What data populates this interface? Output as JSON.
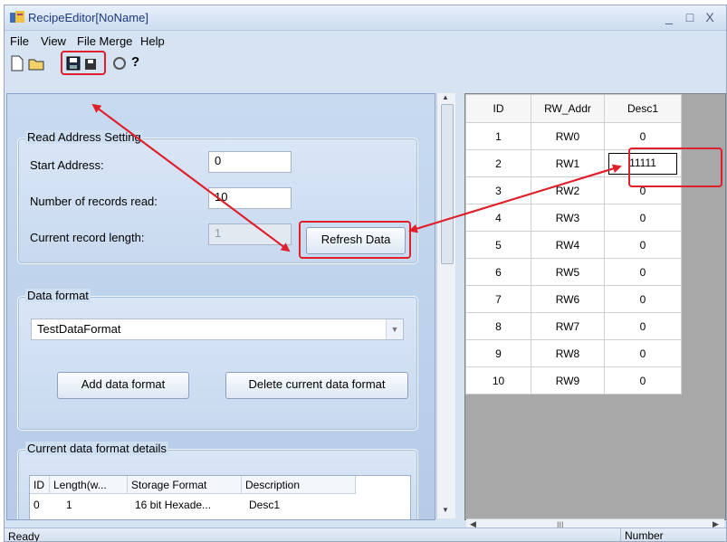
{
  "window": {
    "title": "RecipeEditor[NoName]",
    "minimize": "_",
    "maximize": "□",
    "close": "X"
  },
  "menu": {
    "file": "File",
    "view": "View",
    "file_merge": "File Merge",
    "help": "Help"
  },
  "toolbar": {
    "icons": [
      "new-icon",
      "open-icon",
      "save-icon",
      "save-as-icon",
      "refresh-icon",
      "help-icon"
    ],
    "help_glyph": "?"
  },
  "read_address": {
    "group_label": "Read Address Setting",
    "start_label": "Start Address:",
    "start_value": "0",
    "count_label": "Number of records read:",
    "count_value": "10",
    "length_label": "Current record length:",
    "length_value": "1",
    "refresh_button": "Refresh Data"
  },
  "data_format": {
    "group_label": "Data format",
    "selected": "TestDataFormat",
    "add_button": "Add data format",
    "delete_button": "Delete current data format"
  },
  "details": {
    "group_label": "Current data format details",
    "columns": [
      "ID",
      "Length(w...",
      "Storage Format",
      "Description"
    ],
    "rows": [
      [
        "0",
        "1",
        "16 bit Hexade...",
        "Desc1"
      ]
    ]
  },
  "grid": {
    "columns": [
      "ID",
      "RW_Addr",
      "Desc1"
    ],
    "rows": [
      [
        "1",
        "RW0",
        "0"
      ],
      [
        "2",
        "RW1",
        "11111"
      ],
      [
        "3",
        "RW2",
        "0"
      ],
      [
        "4",
        "RW3",
        "0"
      ],
      [
        "5",
        "RW4",
        "0"
      ],
      [
        "6",
        "RW5",
        "0"
      ],
      [
        "7",
        "RW6",
        "0"
      ],
      [
        "8",
        "RW7",
        "0"
      ],
      [
        "9",
        "RW8",
        "0"
      ],
      [
        "10",
        "RW9",
        "0"
      ]
    ]
  },
  "scroll": {
    "hscroll_glyph": "III"
  },
  "status": {
    "left": "Ready",
    "right": "Number"
  },
  "colors": {
    "annotation": "#e0202a",
    "title_text": "#1d3b7a"
  }
}
